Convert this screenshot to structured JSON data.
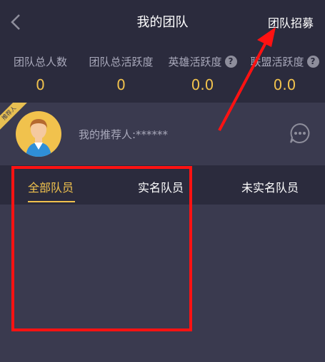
{
  "header": {
    "title": "我的团队",
    "recruit_label": "团队招募"
  },
  "stats": [
    {
      "label": "团队总人数",
      "value": "0"
    },
    {
      "label": "团队总活跃度",
      "value": "0"
    },
    {
      "label": "英雄活跃度",
      "value": "0.0"
    },
    {
      "label": "联盟活跃度",
      "value": "0.0"
    }
  ],
  "referrer": {
    "badge": "推荐人",
    "text": "我的推荐人:******"
  },
  "tabs": [
    {
      "label": "全部队员"
    },
    {
      "label": "实名队员"
    },
    {
      "label": "未实名队员"
    }
  ],
  "colors": {
    "accent": "#f1c24d",
    "annotation": "#ff1212"
  },
  "icons": {
    "back": "chevron-left-icon",
    "help": "question-circle-icon",
    "more": "more-dots-icon"
  }
}
